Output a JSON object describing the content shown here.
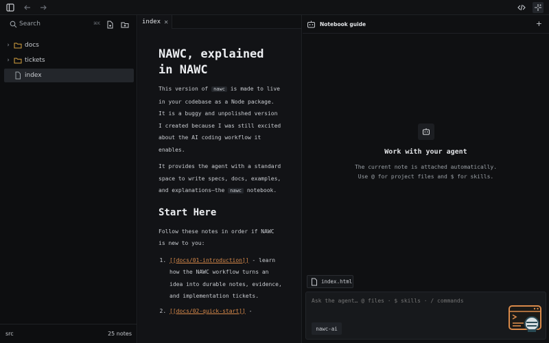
{
  "sidebar": {
    "search_label": "Search",
    "search_shortcut": "⌘K",
    "items": [
      {
        "label": "docs",
        "type": "folder"
      },
      {
        "label": "tickets",
        "type": "folder"
      },
      {
        "label": "index",
        "type": "file"
      }
    ],
    "footer_left": "src",
    "footer_right": "25 notes"
  },
  "editor": {
    "tab_label": "index",
    "heading": "NAWC, explained in NAWC",
    "p1_a": "This version of ",
    "p1_code": "nawc",
    "p1_b": " is made to live in your codebase as a Node package. It is a buggy and unpolished version I created because I was still excited about the AI coding workflow it enables.",
    "p2_a": "It provides the agent with a standard space to write specs, docs, examples, and explanations—the ",
    "p2_code": "nawc",
    "p2_b": " notebook.",
    "h2": "Start Here",
    "p3": "Follow these notes in order if NAWC is new to you:",
    "list": [
      {
        "link": "[[docs/01-introduction]]",
        "text": " - learn how the NAWC workflow turns an idea into durable notes, evidence, and implementation tickets."
      },
      {
        "link": "[[docs/02-quick-start]]",
        "text": " -"
      }
    ]
  },
  "guide": {
    "title": "Notebook guide",
    "plus": "+",
    "empty_title": "Work with your agent",
    "empty_line1": "The current note is attached automatically.",
    "empty_line2": "Use @ for project files and $ for skills.",
    "chip_label": "index.html",
    "composer_placeholder": "Ask the agent… @ files · $ skills · / commands",
    "model_label": "nawc-ai"
  },
  "colors": {
    "accent": "#d98a4a",
    "background": "#0d0e10"
  }
}
